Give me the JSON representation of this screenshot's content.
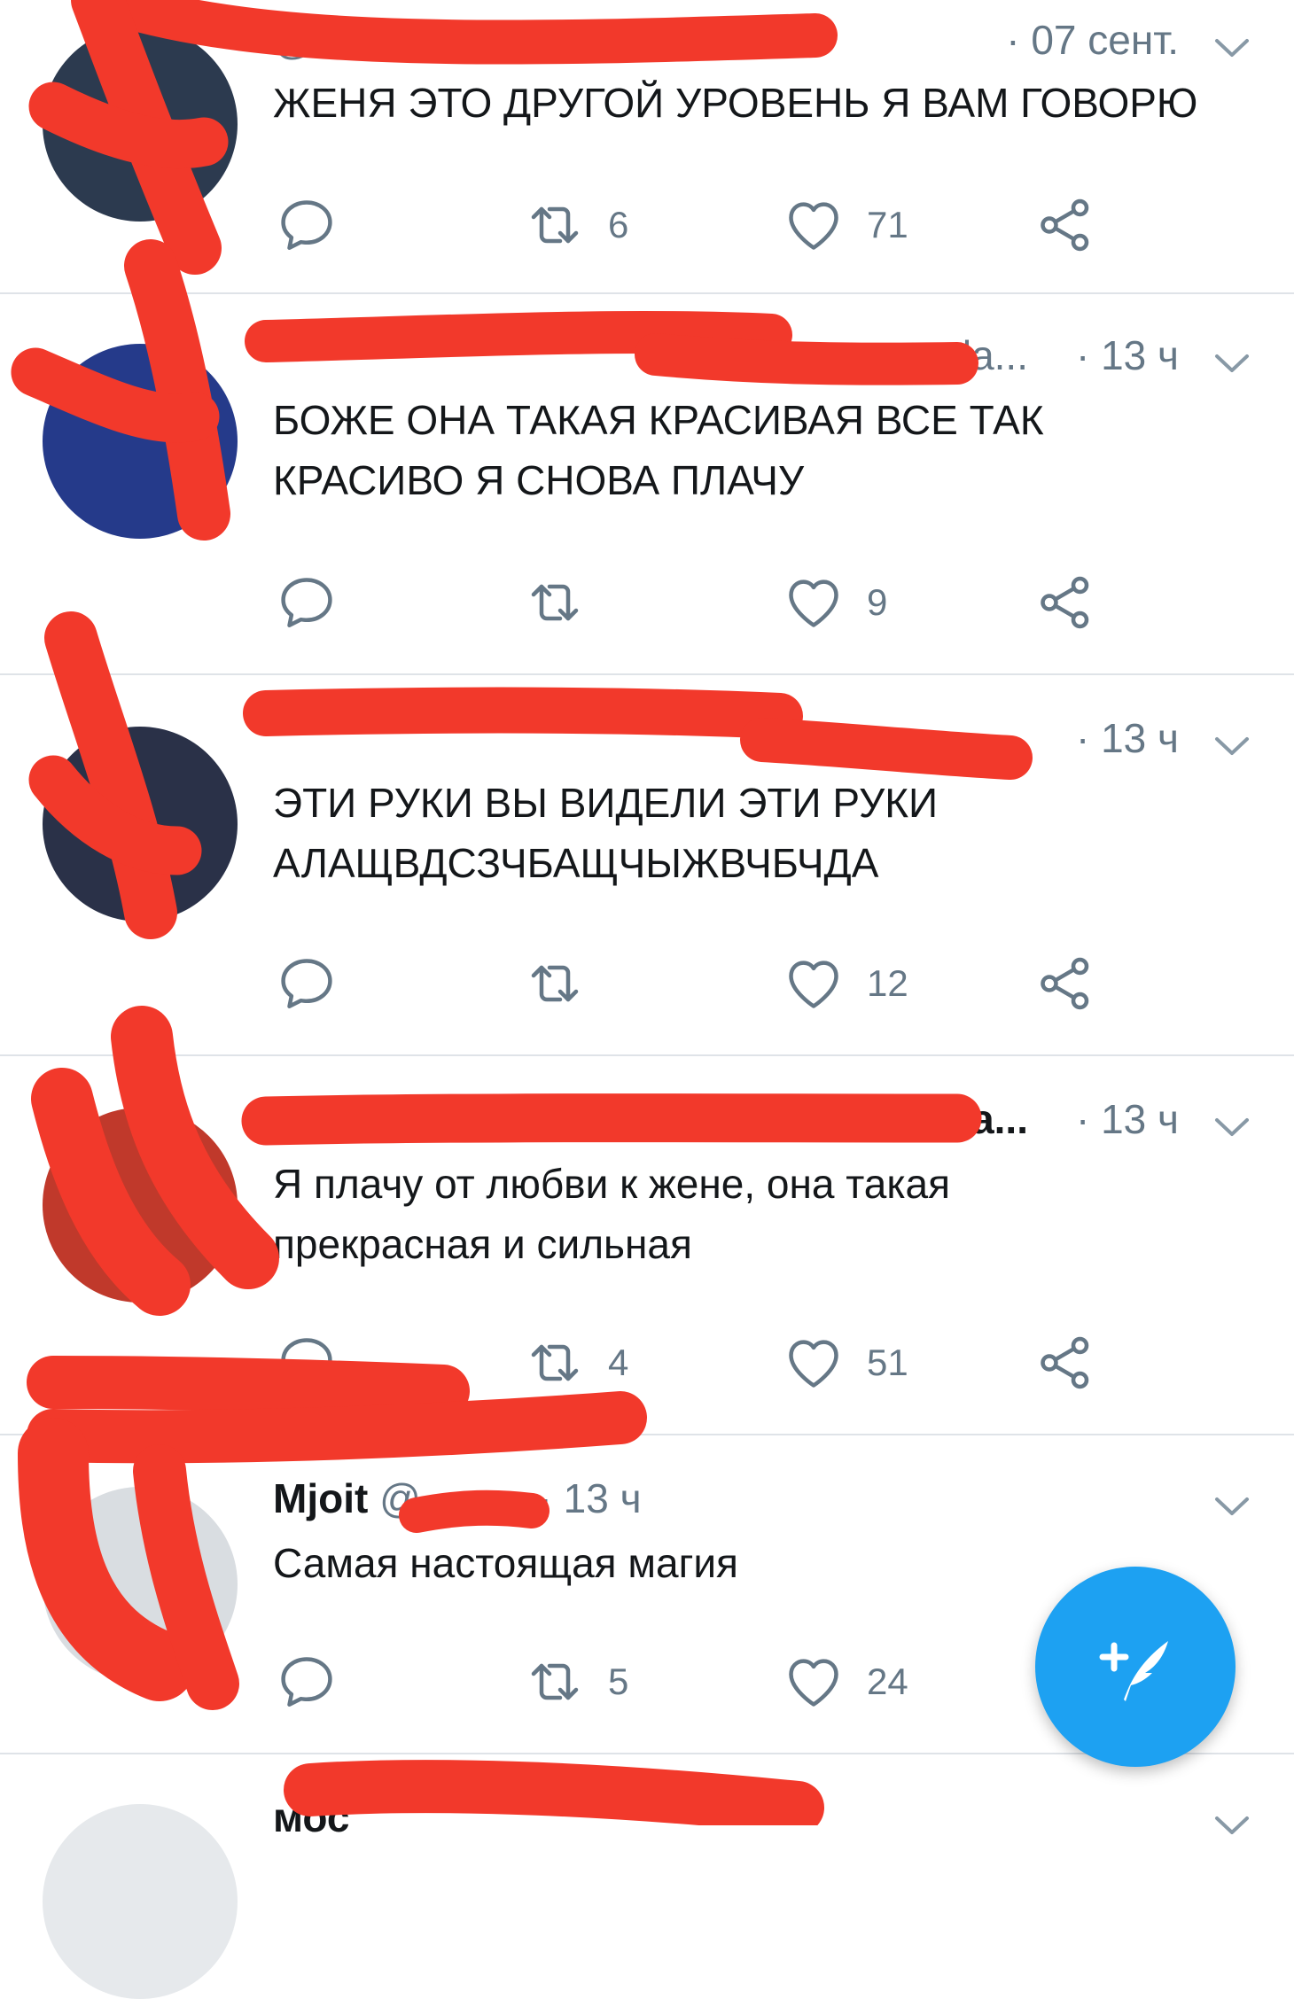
{
  "tweets": [
    {
      "name": "",
      "handle": "@Clo",
      "time": "· 07 сент.",
      "text": "ЖЕНЯ ЭТО ДРУГОЙ УРОВЕНЬ Я ВАМ ГОВОРЮ",
      "retweets": "6",
      "likes": "71",
      "avatar_color": "#2c3a4f"
    },
    {
      "name": "",
      "handle": "la...",
      "time": "· 13 ч",
      "text": "БОЖЕ ОНА ТАКАЯ КРАСИВАЯ ВСЕ ТАК КРАСИВО Я СНОВА ПЛАЧУ",
      "retweets": "",
      "likes": "9",
      "avatar_color": "#253a8a"
    },
    {
      "name": "",
      "handle": "",
      "time": "· 13 ч",
      "text": "ЭТИ РУКИ ВЫ ВИДЕЛИ ЭТИ РУКИ АЛАЩВДСЗЧБАЩЧЫЖВЧБЧДА",
      "retweets": "",
      "likes": "12",
      "avatar_color": "#2a3148"
    },
    {
      "name": "",
      "handle": "а...",
      "time": "· 13 ч",
      "text": "Я плачу от любви к жене, она такая прекрасная и сильная",
      "retweets": "4",
      "likes": "51",
      "avatar_color": "#c0392b"
    },
    {
      "name": "Mjoit",
      "handle": "@",
      "time": "· 13 ч",
      "text": "Самая настоящая магия",
      "retweets": "5",
      "likes": "24",
      "avatar_color": "#d9dde1"
    },
    {
      "name": "мос",
      "handle": "",
      "time": "",
      "text": "",
      "retweets": "",
      "likes": "",
      "avatar_color": "#e6e9ec"
    }
  ],
  "colors": {
    "accent": "#1da1f2",
    "icon": "#657786",
    "scribble": "#f2392b",
    "divider": "#dfe3e8"
  },
  "icons": {
    "reply": "reply-icon",
    "retweet": "retweet-icon",
    "like": "heart-icon",
    "share": "share-icon",
    "caret": "chevron-down-icon",
    "compose": "compose-tweet-icon"
  }
}
